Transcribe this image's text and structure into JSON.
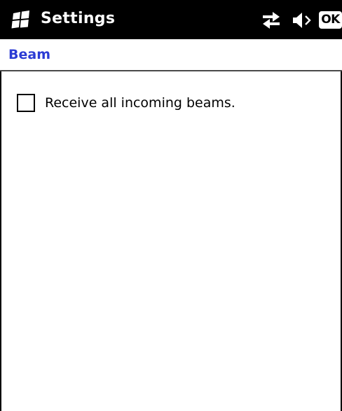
{
  "titlebar": {
    "app_title": "Settings",
    "start_icon": "windows-flag-icon",
    "connectivity_icon": "connectivity-arrows-icon",
    "volume_icon": "speaker-icon",
    "ok_label": "OK"
  },
  "page": {
    "title": "Beam",
    "title_color": "#2b3bd4"
  },
  "options": {
    "receive_beams": {
      "label": "Receive all incoming beams.",
      "checked": false
    }
  }
}
